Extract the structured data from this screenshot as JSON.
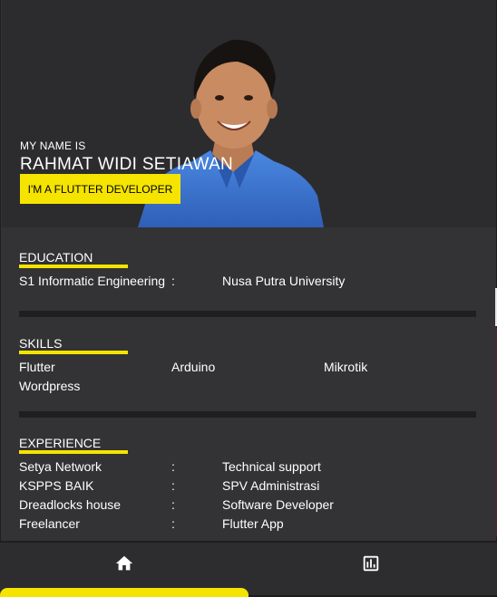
{
  "profile": {
    "intro": "MY NAME IS",
    "name": "RAHMAT WIDI SETIAWAN",
    "tagline": "I'M A FLUTTER DEVELOPER"
  },
  "education": {
    "title": "EDUCATION",
    "degree": "S1 Informatic Engineering",
    "separator": ":",
    "institution": "Nusa Putra University"
  },
  "skills": {
    "title": "SKILLS",
    "items": [
      "Flutter",
      "Arduino",
      "Mikrotik",
      "Wordpress"
    ]
  },
  "experience": {
    "title": "EXPERIENCE",
    "rows": [
      {
        "company": "Setya Network",
        "separator": ":",
        "role": "Technical support"
      },
      {
        "company": "KSPPS BAIK",
        "separator": ":",
        "role": "SPV Administrasi"
      },
      {
        "company": "Dreadlocks house",
        "separator": ":",
        "role": "Software Developer"
      },
      {
        "company": "Freelancer",
        "separator": ":",
        "role": "Flutter App"
      }
    ]
  },
  "bottom_nav": {
    "items": [
      {
        "icon": "home-icon"
      },
      {
        "icon": "chart-icon"
      }
    ]
  },
  "colors": {
    "accent": "#f5e400",
    "background": "#333335",
    "hero_background": "#2c2c2f",
    "divider": "#1f1f1f",
    "shirt": "#3b78d6"
  }
}
